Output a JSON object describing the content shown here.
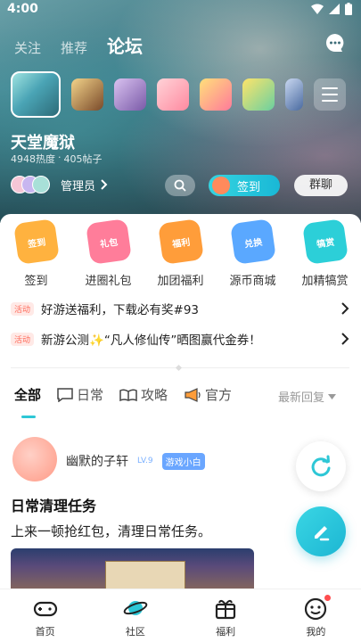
{
  "status": {
    "time": "4:00"
  },
  "top_tabs": [
    {
      "label": "关注"
    },
    {
      "label": "推荐"
    },
    {
      "label": "论坛"
    }
  ],
  "forum": {
    "title": "天堂魔狱",
    "heat": "4948热度",
    "separator": "·",
    "posts": "405帖子",
    "admin_label": "管理员",
    "checkin_label": "签到",
    "group_chat_label": "群聊"
  },
  "quick_actions": [
    {
      "label": "签到",
      "icon_text": "签到",
      "color": "#ffb23f"
    },
    {
      "label": "进圈礼包",
      "icon_text": "礼包",
      "color": "#ff7d9a"
    },
    {
      "label": "加团福利",
      "icon_text": "福利",
      "color": "#ff9d3a"
    },
    {
      "label": "源币商城",
      "icon_text": "兑换",
      "color": "#5aa8ff"
    },
    {
      "label": "加精犒赏",
      "icon_text": "犒赏",
      "color": "#2ccfd8"
    }
  ],
  "notices": [
    {
      "tag": "活动",
      "text": "好游送福利，下载必有奖#93"
    },
    {
      "tag": "活动",
      "text": "新游公测✨“凡人修仙传”晒图赢代金券！"
    }
  ],
  "category_tabs": [
    {
      "label": "全部"
    },
    {
      "label": "日常"
    },
    {
      "label": "攻略"
    },
    {
      "label": "官方"
    }
  ],
  "sort_label": "最新回复",
  "post": {
    "author": "幽默的子轩",
    "level": "LV.9",
    "badge": "游戏小白",
    "title": "日常清理任务",
    "body": "上来一顿抢红包，清理日常任务。"
  },
  "bottom_nav": [
    {
      "label": "首页"
    },
    {
      "label": "社区"
    },
    {
      "label": "福利"
    },
    {
      "label": "我的"
    }
  ],
  "colors": {
    "accent": "#2ec7d6",
    "notice_tag": "#ff6b5b"
  }
}
